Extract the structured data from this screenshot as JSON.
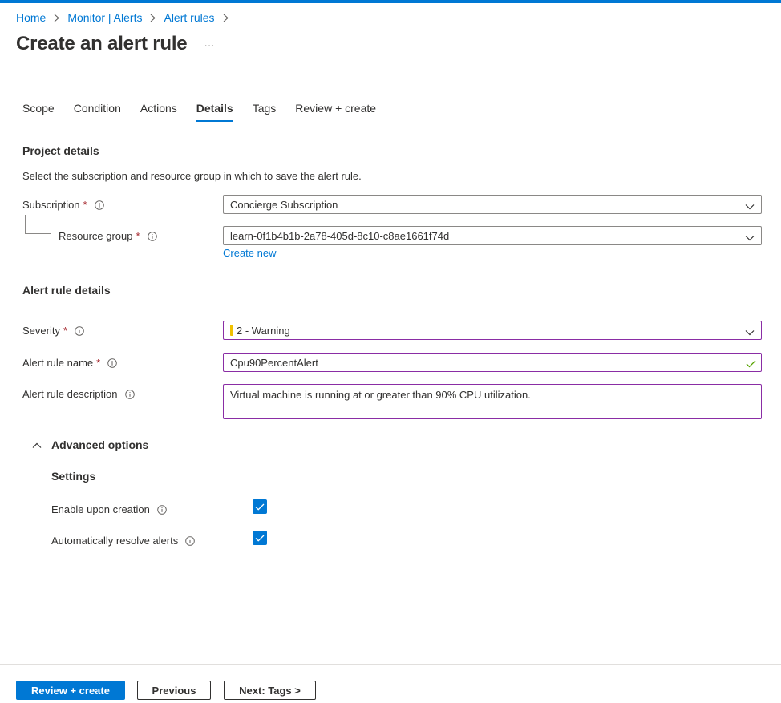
{
  "breadcrumb": [
    "Home",
    "Monitor | Alerts",
    "Alert rules"
  ],
  "page_title": "Create an alert rule",
  "more_label": "···",
  "tabs": [
    "Scope",
    "Condition",
    "Actions",
    "Details",
    "Tags",
    "Review + create"
  ],
  "active_tab": "Details",
  "project": {
    "title": "Project details",
    "description": "Select the subscription and resource group in which to save the alert rule.",
    "subscription_label": "Subscription",
    "subscription_value": "Concierge Subscription",
    "resource_group_label": "Resource group",
    "resource_group_value": "learn-0f1b4b1b-2a78-405d-8c10-c8ae1661f74d",
    "create_new": "Create new"
  },
  "alert": {
    "title": "Alert rule details",
    "severity_label": "Severity",
    "severity_value": "2 - Warning",
    "severity_color": "#f0c100",
    "name_label": "Alert rule name",
    "name_value": "Cpu90PercentAlert",
    "description_label": "Alert rule description",
    "description_value": "Virtual machine is running at or greater than 90% CPU utilization."
  },
  "advanced": {
    "title": "Advanced options",
    "settings_title": "Settings",
    "enable_label": "Enable upon creation",
    "enable_checked": true,
    "resolve_label": "Automatically resolve alerts",
    "resolve_checked": true
  },
  "footer": {
    "review_create": "Review + create",
    "previous": "Previous",
    "next": "Next: Tags >"
  },
  "required_marker": "*",
  "colors": {
    "accent": "#0078d4",
    "required": "#a4262c",
    "focus_border": "#8a2da5",
    "valid_check": "#57a300"
  },
  "icons": [
    "chevron-right-icon",
    "more-icon",
    "info-icon",
    "chevron-down-icon",
    "check-icon",
    "chevron-up-icon",
    "checkbox-checked-icon"
  ]
}
